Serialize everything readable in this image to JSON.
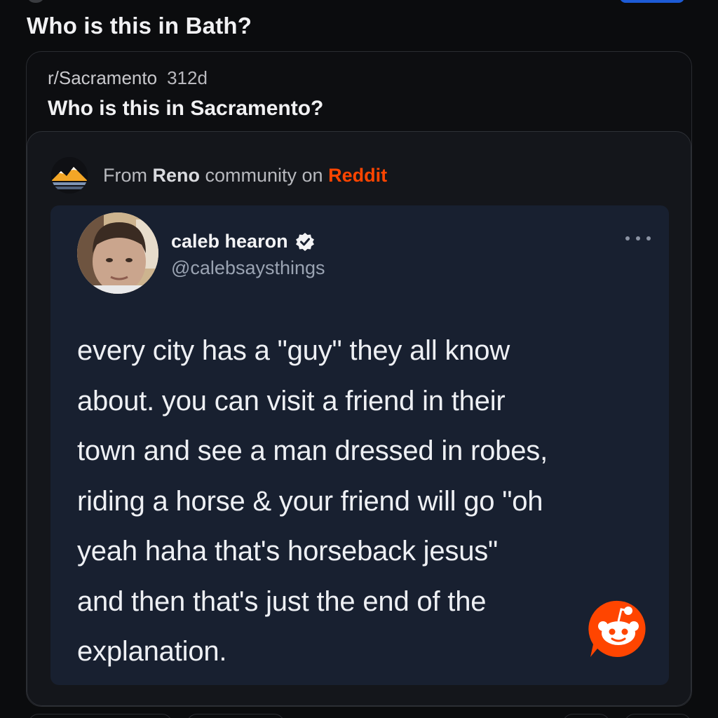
{
  "post": {
    "title": "Who is this in Bath?"
  },
  "crosspost": {
    "subreddit": "r/Sacramento",
    "age": "312d",
    "title": "Who is this in Sacramento?"
  },
  "embed": {
    "prefix": "From ",
    "community": "Reno",
    "middle": " community on ",
    "platform": "Reddit",
    "logo_icon": "reno-mountains-icon"
  },
  "tweet": {
    "author_name": "caleb hearon",
    "handle": "@calebsaysthings",
    "verified_icon": "verified-check-icon",
    "more_icon": "more-horizontal-icon",
    "lines": [
      "every city has a \"guy\" they all know",
      "about. you can visit a friend in their",
      "town and see a man dressed in robes,",
      "riding a horse & your friend will go \"oh",
      "yeah haha that's horseback jesus\"",
      "and then that's just the end of the",
      "explanation."
    ],
    "watermark_icon": "reddit-snoo-icon"
  },
  "colors": {
    "background": "#0b0c0e",
    "card": "#0d0e11",
    "embed": "#14161b",
    "tweet": "#182030",
    "reddit_orange": "#ff4500",
    "join_blue": "#1d5bd6"
  }
}
